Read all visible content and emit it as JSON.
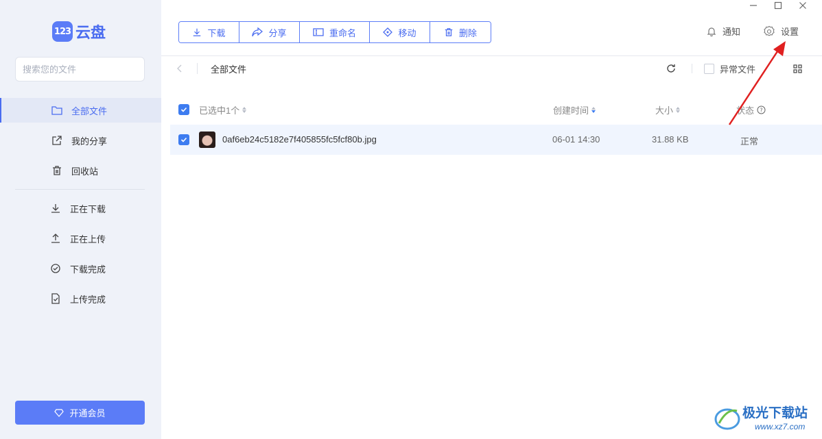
{
  "app": {
    "logo_badge": "123",
    "logo_text": "云盘"
  },
  "sidebar": {
    "search_placeholder": "搜索您的文件",
    "items": [
      {
        "label": "全部文件",
        "icon": "folder-icon",
        "active": true
      },
      {
        "label": "我的分享",
        "icon": "share-icon"
      },
      {
        "label": "回收站",
        "icon": "trash-icon"
      },
      {
        "label": "正在下载",
        "icon": "download-icon"
      },
      {
        "label": "正在上传",
        "icon": "upload-icon"
      },
      {
        "label": "下载完成",
        "icon": "check-circle-icon"
      },
      {
        "label": "上传完成",
        "icon": "file-check-icon"
      }
    ],
    "vip_label": "开通会员"
  },
  "toolbar": {
    "download": "下载",
    "share": "分享",
    "rename": "重命名",
    "move": "移动",
    "delete": "删除"
  },
  "header": {
    "notify": "通知",
    "settings": "设置"
  },
  "path": {
    "current": "全部文件",
    "abnormal_label": "异常文件"
  },
  "table": {
    "selected_label": "已选中1个",
    "col_created": "创建时间",
    "col_size": "大小",
    "col_status": "状态",
    "rows": [
      {
        "name": "0af6eb24c5182e7f405855fc5fcf80b.jpg",
        "created": "06-01 14:30",
        "size": "31.88 KB",
        "status": "正常"
      }
    ]
  },
  "colors": {
    "accent": "#4a6cf0",
    "sidebar_bg": "#eff2f9",
    "annotation_arrow": "#e02020"
  },
  "watermark": {
    "text": "极光下载站",
    "url": "www.xz7.com"
  }
}
